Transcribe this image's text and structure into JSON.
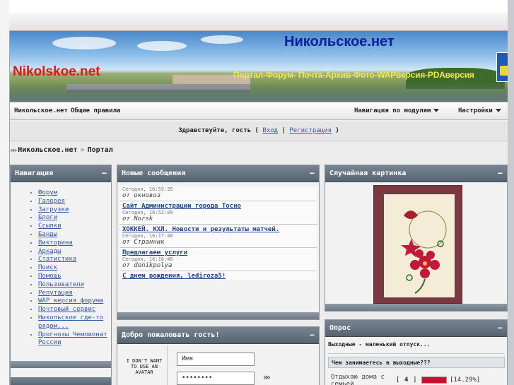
{
  "banner": {
    "title": "Никольское.нет",
    "subtitle_left": "Nikolskoe.net",
    "links": "Портал-Форум- Почта-Архив-Фото-WAPверсия-PDAверсия"
  },
  "navbar": {
    "home": "Никольское.нет",
    "rules": "Общие правила",
    "module_nav": "Навигация по модулям",
    "settings": "Настройки"
  },
  "greeting": {
    "text_before": "Здравствуйте, гость ( ",
    "login": "Вход",
    "sep": " | ",
    "register": "Регистрация",
    "text_after": " )"
  },
  "breadcrumb": {
    "home": "Никольское.нет",
    "sep": "»",
    "current": "Портал"
  },
  "navigation": {
    "title": "Навигация",
    "items": [
      "Форум",
      "Галерея",
      "Загрузки",
      "Блоги",
      "Ссылки",
      "Банды",
      "Викторина",
      "Аркады",
      "Статистика",
      "Поиск",
      "Помощь",
      "Пользователи",
      "Репутация",
      "WAP версия форума",
      "Почтовый сервис",
      "Никольское где-то рядом...",
      "Прогнозы Чемпионат России"
    ]
  },
  "new_posts": {
    "title": "Новые сообщения",
    "posts": [
      {
        "title": "",
        "date": "Сегодня, 16:59:35",
        "author": "от окновоз"
      },
      {
        "title": "Сайт Администрации города Тосно ",
        "date": "Сегодня, 16:52:09",
        "author": "от Norsk"
      },
      {
        "title": "ХОККЕЙ. КХЛ. Новости и результаты матчей. ",
        "date": "Сегодня, 16:17:40",
        "author": "от Странник"
      },
      {
        "title": "Предлагаем услуги ",
        "date": "Сегодня, 16:16:40",
        "author": "от donikpolya"
      },
      {
        "title": "С днем рождения, lediroza5! ",
        "date": "",
        "author": ""
      }
    ]
  },
  "random_picture": {
    "title": "Случайная картинка"
  },
  "welcome": {
    "title": "Добро пожаловать гость!",
    "avatar_text": "I DON'T WANT TO USE AN AVATAR",
    "username_placeholder": "Имя",
    "password_value": "••••••••"
  },
  "poll": {
    "title": "Опрос",
    "name": "Выходные - маленький отпуск...",
    "question": "Чем занимаетесь в выходные???",
    "option_label": "Отдыхаю дома с семьей",
    "option_count": "4",
    "option_percent": "[14.29%]",
    "option_fraction": 0.1429
  },
  "colors": {
    "panel_header": "#566370",
    "link": "#3458a8",
    "brand_red": "#e01818",
    "brand_blue": "#0d1f9c",
    "poll_bar": "#c8102e"
  }
}
